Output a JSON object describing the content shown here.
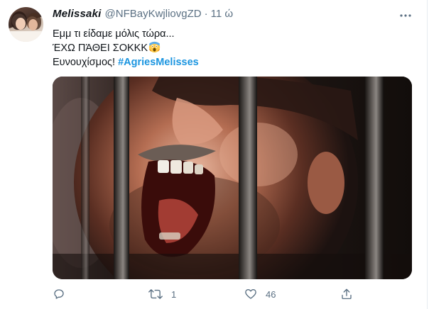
{
  "tweet": {
    "display_name": "Melissaki",
    "handle": "@NFBayKwjliovgZD",
    "separator": "·",
    "time": "11 ώ",
    "lines": [
      "Εμμ τι είδαμε μόλις τώρα...",
      "ΈΧΩ ΠΆΘΕΙ ΣΟΚΚΚ",
      "Ευνουχίσμος! "
    ],
    "hashtag": "#AgriesMelisses",
    "emoji": "screaming-face-emoji"
  },
  "media": {
    "description_icon": "gif-image"
  },
  "actions": {
    "reply_count": "",
    "retweet_count": "1",
    "like_count": "46",
    "share_count": ""
  },
  "colors": {
    "text": "#0f1419",
    "secondary": "#5b7083",
    "accent": "#1b95e0"
  }
}
